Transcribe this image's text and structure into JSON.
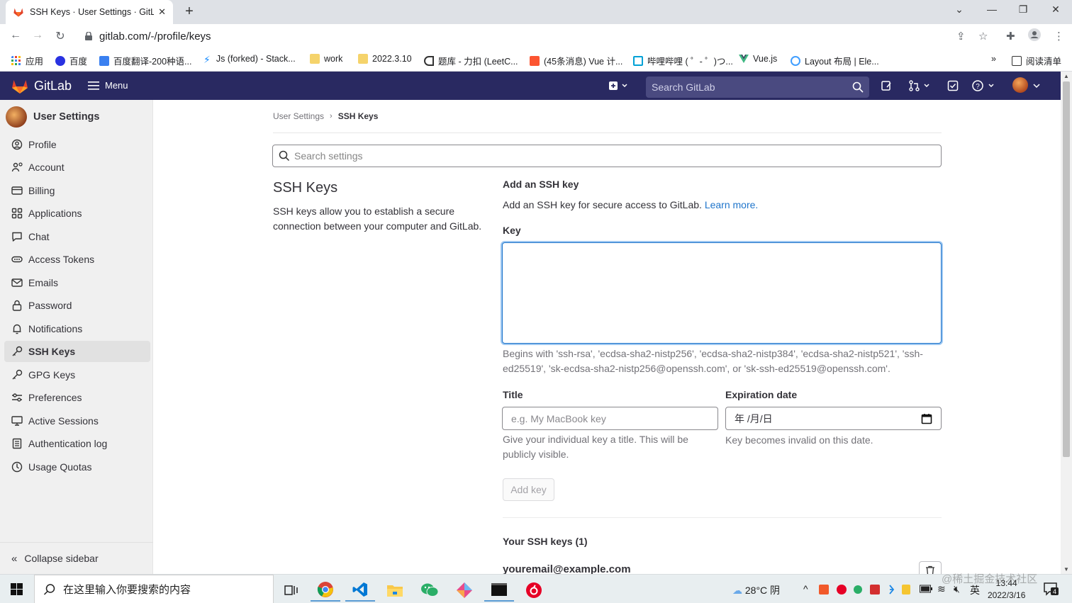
{
  "browser": {
    "tab_title": "SSH Keys · User Settings · GitL",
    "url": "gitlab.com/-/profile/keys",
    "bookmarks": [
      {
        "label": "应用",
        "icon": "apps-grid-icon"
      },
      {
        "label": "百度",
        "icon": "baidu-paw-icon"
      },
      {
        "label": "百度翻译-200种语...",
        "icon": "baidu-translate-icon"
      },
      {
        "label": "Js (forked) - Stack...",
        "icon": "stackblitz-bolt-icon"
      },
      {
        "label": "work",
        "icon": "folder-icon"
      },
      {
        "label": "2022.3.10",
        "icon": "folder-icon"
      },
      {
        "label": "题库 - 力扣 (LeetC...",
        "icon": "leetcode-icon"
      },
      {
        "label": "(45条消息) Vue 计...",
        "icon": "csdn-icon"
      },
      {
        "label": "哔哩哔哩 ( ゜- ゜)つ...",
        "icon": "bilibili-tv-icon"
      },
      {
        "label": "Vue.js",
        "icon": "vue-logo-icon"
      },
      {
        "label": "Layout 布局 | Ele...",
        "icon": "element-ui-icon"
      }
    ],
    "more_bookmarks": "»",
    "reading_list": "阅读清单"
  },
  "header": {
    "brand": "GitLab",
    "menu_label": "Menu",
    "search_placeholder": "Search GitLab"
  },
  "sidebar": {
    "context_title": "User Settings",
    "items": [
      {
        "label": "Profile",
        "icon": "profile-icon",
        "active": false
      },
      {
        "label": "Account",
        "icon": "account-icon",
        "active": false
      },
      {
        "label": "Billing",
        "icon": "billing-icon",
        "active": false
      },
      {
        "label": "Applications",
        "icon": "applications-icon",
        "active": false
      },
      {
        "label": "Chat",
        "icon": "chat-icon",
        "active": false
      },
      {
        "label": "Access Tokens",
        "icon": "token-icon",
        "active": false
      },
      {
        "label": "Emails",
        "icon": "mail-icon",
        "active": false
      },
      {
        "label": "Password",
        "icon": "lock-icon",
        "active": false
      },
      {
        "label": "Notifications",
        "icon": "bell-icon",
        "active": false
      },
      {
        "label": "SSH Keys",
        "icon": "key-icon",
        "active": true
      },
      {
        "label": "GPG Keys",
        "icon": "key-icon",
        "active": false
      },
      {
        "label": "Preferences",
        "icon": "preferences-icon",
        "active": false
      },
      {
        "label": "Active Sessions",
        "icon": "monitor-icon",
        "active": false
      },
      {
        "label": "Authentication log",
        "icon": "log-icon",
        "active": false
      },
      {
        "label": "Usage Quotas",
        "icon": "quota-icon",
        "active": false
      }
    ],
    "collapse_label": "Collapse sidebar"
  },
  "main": {
    "breadcrumb": [
      "User Settings",
      "SSH Keys"
    ],
    "search_placeholder": "Search settings",
    "section_title": "SSH Keys",
    "section_desc": "SSH keys allow you to establish a secure connection between your computer and GitLab.",
    "form_heading": "Add an SSH key",
    "form_sub": "Add an SSH key for secure access to GitLab.",
    "learn_more": "Learn more.",
    "key_label": "Key",
    "key_value": "",
    "key_help": "Begins with 'ssh-rsa', 'ecdsa-sha2-nistp256', 'ecdsa-sha2-nistp384', 'ecdsa-sha2-nistp521', 'ssh-ed25519', 'sk-ecdsa-sha2-nistp256@openssh.com', or 'sk-ssh-ed25519@openssh.com'.",
    "title_label": "Title",
    "title_placeholder": "e.g. My MacBook key",
    "title_help": "Give your individual key a title. This will be publicly visible.",
    "expiry_label": "Expiration date",
    "expiry_value": "年 /月/日",
    "expiry_help": "Key becomes invalid on this date.",
    "add_button": "Add key",
    "your_keys_heading": "Your SSH keys (1)",
    "keys": [
      {
        "title": "youremail@example.com"
      }
    ]
  },
  "taskbar": {
    "search_placeholder": "在这里输入你要搜索的内容",
    "weather": "28°C 阴",
    "ime": "英",
    "time": "13:44",
    "date": "2022/3/16",
    "notifications": "4"
  },
  "watermark": "@稀土掘金技术社区",
  "colors": {
    "header_bg": "#292961",
    "link": "#1f75cb",
    "sidebar_bg": "#f0f0f0"
  }
}
